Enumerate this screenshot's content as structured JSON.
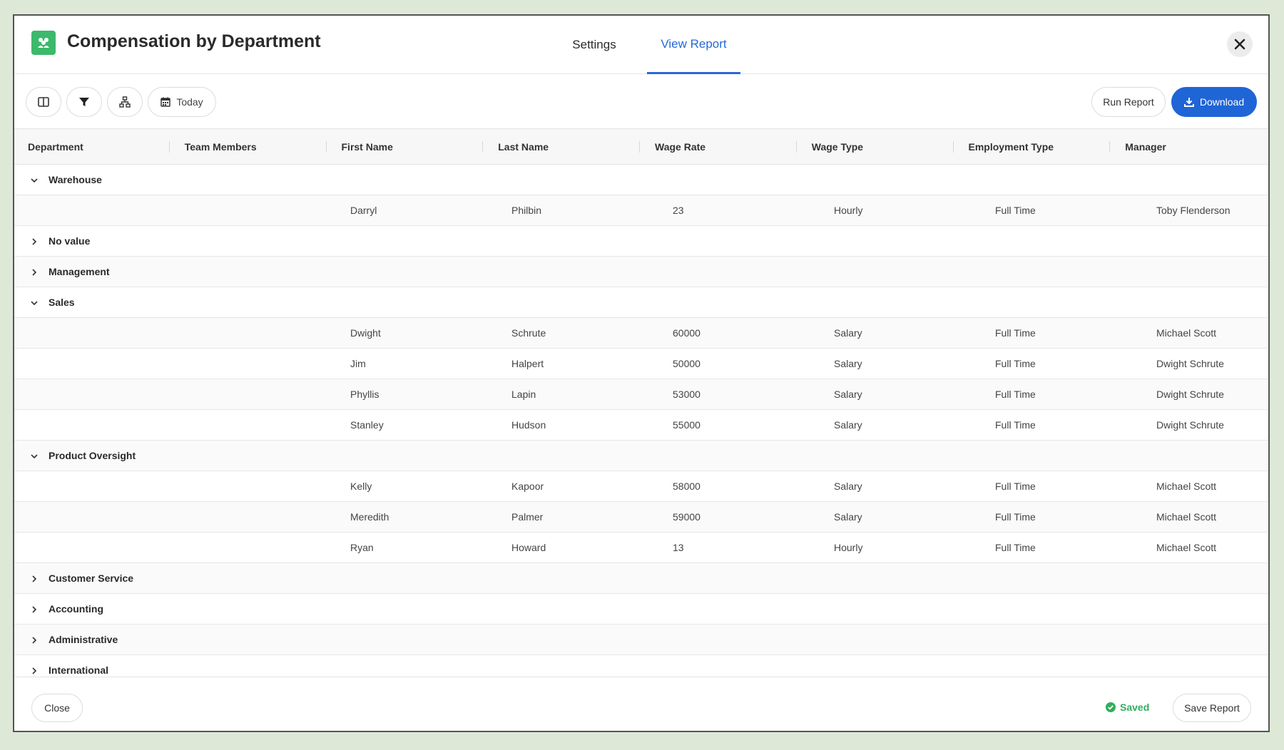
{
  "header": {
    "title": "Compensation by Department",
    "tabs": [
      {
        "label": "Settings",
        "active": false
      },
      {
        "label": "View Report",
        "active": true
      }
    ]
  },
  "toolbar": {
    "date_label": "Today",
    "run_label": "Run Report",
    "download_label": "Download"
  },
  "table": {
    "columns": [
      "Department",
      "Team Members",
      "First Name",
      "Last Name",
      "Wage Rate",
      "Wage Type",
      "Employment Type",
      "Manager"
    ],
    "rows": [
      {
        "kind": "group",
        "label": "Warehouse",
        "expanded": true
      },
      {
        "kind": "data",
        "first": "Darryl",
        "last": "Philbin",
        "wage_rate": "23",
        "wage_type": "Hourly",
        "employment": "Full Time",
        "manager": "Toby Flenderson"
      },
      {
        "kind": "group",
        "label": "No value",
        "expanded": false
      },
      {
        "kind": "group",
        "label": "Management",
        "expanded": false
      },
      {
        "kind": "group",
        "label": "Sales",
        "expanded": true
      },
      {
        "kind": "data",
        "first": "Dwight",
        "last": "Schrute",
        "wage_rate": "60000",
        "wage_type": "Salary",
        "employment": "Full Time",
        "manager": "Michael Scott"
      },
      {
        "kind": "data",
        "first": "Jim",
        "last": "Halpert",
        "wage_rate": "50000",
        "wage_type": "Salary",
        "employment": "Full Time",
        "manager": "Dwight Schrute"
      },
      {
        "kind": "data",
        "first": "Phyllis",
        "last": "Lapin",
        "wage_rate": "53000",
        "wage_type": "Salary",
        "employment": "Full Time",
        "manager": "Dwight Schrute"
      },
      {
        "kind": "data",
        "first": "Stanley",
        "last": "Hudson",
        "wage_rate": "55000",
        "wage_type": "Salary",
        "employment": "Full Time",
        "manager": "Dwight Schrute"
      },
      {
        "kind": "group",
        "label": "Product Oversight",
        "expanded": true
      },
      {
        "kind": "data",
        "first": "Kelly",
        "last": "Kapoor",
        "wage_rate": "58000",
        "wage_type": "Salary",
        "employment": "Full Time",
        "manager": "Michael Scott"
      },
      {
        "kind": "data",
        "first": "Meredith",
        "last": "Palmer",
        "wage_rate": "59000",
        "wage_type": "Salary",
        "employment": "Full Time",
        "manager": "Michael Scott"
      },
      {
        "kind": "data",
        "first": "Ryan",
        "last": "Howard",
        "wage_rate": "13",
        "wage_type": "Hourly",
        "employment": "Full Time",
        "manager": "Michael Scott"
      },
      {
        "kind": "group",
        "label": "Customer Service",
        "expanded": false
      },
      {
        "kind": "group",
        "label": "Accounting",
        "expanded": false
      },
      {
        "kind": "group",
        "label": "Administrative",
        "expanded": false
      },
      {
        "kind": "group",
        "label": "International",
        "expanded": false
      }
    ]
  },
  "footer": {
    "close_label": "Close",
    "saved_label": "Saved",
    "save_label": "Save Report"
  },
  "colors": {
    "accent": "#1f65d6",
    "app_icon": "#3cb96b",
    "saved": "#2fae5c"
  },
  "icons": {
    "app": "people-group-icon",
    "close": "close-icon",
    "columns": "columns-icon",
    "filter": "filter-icon",
    "group": "hierarchy-icon",
    "date": "calendar-icon",
    "download": "download-icon",
    "saved": "check-circle-icon"
  }
}
